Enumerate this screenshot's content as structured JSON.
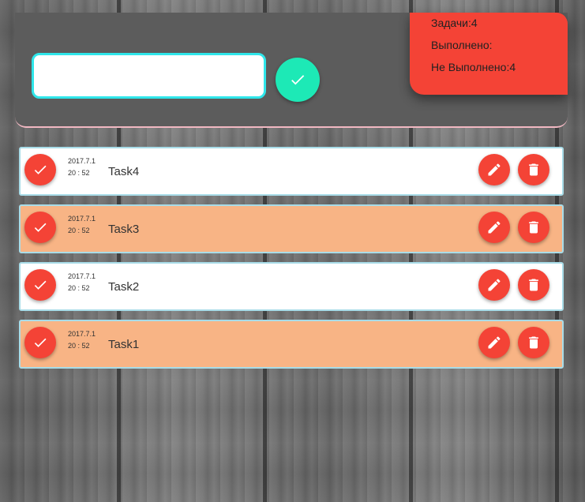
{
  "header": {
    "input_value": "",
    "input_placeholder": ""
  },
  "stats": {
    "total_label": "Задачи:4",
    "done_label": "Выполнено:",
    "not_done_label": "Не Выполнено:4"
  },
  "tasks": [
    {
      "date": "2017.7.1",
      "time": "20 : 52",
      "name": "Task4",
      "style": "white"
    },
    {
      "date": "2017.7.1",
      "time": "20 : 52",
      "name": "Task3",
      "style": "orange"
    },
    {
      "date": "2017.7.1",
      "time": "20 : 52",
      "name": "Task2",
      "style": "white"
    },
    {
      "date": "2017.7.1",
      "time": "20 : 52",
      "name": "Task1",
      "style": "orange"
    }
  ],
  "icons": {
    "add": "check-icon",
    "done": "check-icon",
    "edit": "pencil-icon",
    "delete": "trash-icon"
  },
  "colors": {
    "accent_red": "#f44336",
    "accent_teal": "#1de9b6",
    "input_border": "#2fe6ea",
    "row_orange": "#f8b485",
    "row_white": "#ffffff",
    "header_bg": "#5c5c5c"
  }
}
